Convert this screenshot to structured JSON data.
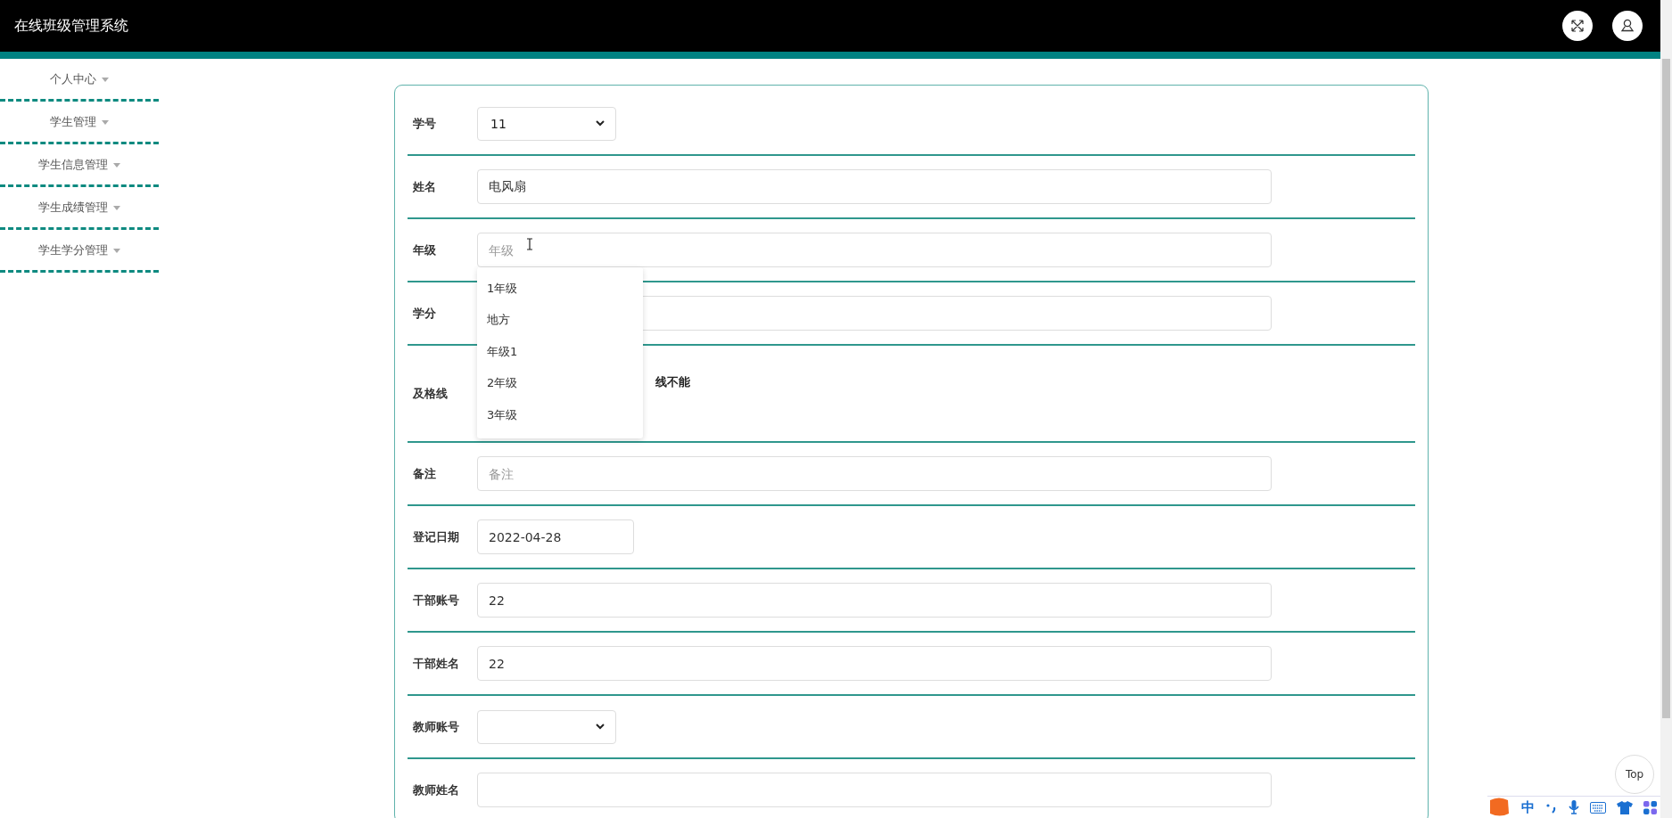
{
  "header": {
    "title": "在线班级管理系统"
  },
  "sidebar": {
    "items": [
      {
        "label": "个人中心"
      },
      {
        "label": "学生管理"
      },
      {
        "label": "学生信息管理"
      },
      {
        "label": "学生成绩管理"
      },
      {
        "label": "学生学分管理"
      }
    ]
  },
  "form": {
    "fields": [
      {
        "label": "学号",
        "kind": "select",
        "value": "11"
      },
      {
        "label": "姓名",
        "kind": "text",
        "value": "电风扇"
      },
      {
        "label": "年级",
        "kind": "text",
        "placeholder": "年级",
        "suggestions": [
          "1年级",
          "地方",
          "年级1",
          "2年级",
          "3年级"
        ]
      },
      {
        "label": "学分",
        "kind": "text"
      },
      {
        "label": "及格线",
        "kind": "note",
        "note": "线不能"
      },
      {
        "label": "备注",
        "kind": "text",
        "placeholder": "备注"
      },
      {
        "label": "登记日期",
        "kind": "date",
        "value": "2022-04-28"
      },
      {
        "label": "干部账号",
        "kind": "text",
        "value": "22"
      },
      {
        "label": "干部姓名",
        "kind": "text",
        "value": "22"
      },
      {
        "label": "教师账号",
        "kind": "select"
      },
      {
        "label": "教师姓名",
        "kind": "text"
      }
    ]
  },
  "back_to_top": {
    "label": "Top"
  },
  "ime_bar": {
    "mode": "中"
  }
}
